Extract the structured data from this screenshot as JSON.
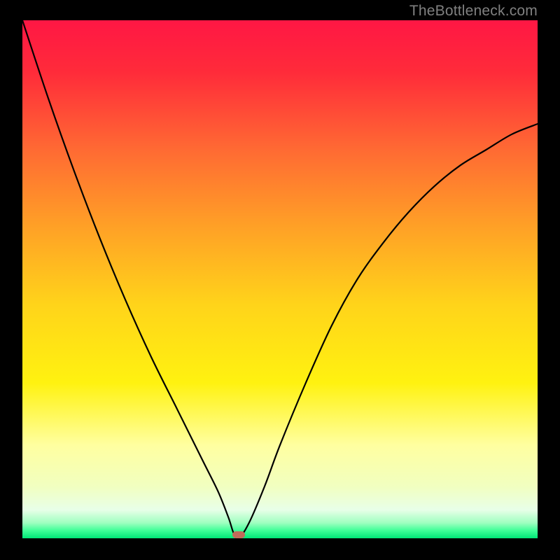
{
  "watermark": "TheBottleneck.com",
  "chart_data": {
    "type": "line",
    "title": "",
    "xlabel": "",
    "ylabel": "",
    "xlim": [
      0,
      100
    ],
    "ylim": [
      0,
      100
    ],
    "grid": false,
    "gradient_stops": [
      {
        "offset": 0.0,
        "color": "#ff1744"
      },
      {
        "offset": 0.1,
        "color": "#ff2b3a"
      },
      {
        "offset": 0.25,
        "color": "#ff6a33"
      },
      {
        "offset": 0.4,
        "color": "#ffa126"
      },
      {
        "offset": 0.55,
        "color": "#ffd41a"
      },
      {
        "offset": 0.7,
        "color": "#fff210"
      },
      {
        "offset": 0.82,
        "color": "#ffffa0"
      },
      {
        "offset": 0.9,
        "color": "#f1ffc0"
      },
      {
        "offset": 0.945,
        "color": "#e8ffe8"
      },
      {
        "offset": 0.97,
        "color": "#a0ffc0"
      },
      {
        "offset": 0.985,
        "color": "#3fff98"
      },
      {
        "offset": 1.0,
        "color": "#00e676"
      }
    ],
    "series": [
      {
        "name": "bottleneck-curve",
        "x": [
          0,
          5,
          10,
          15,
          20,
          25,
          30,
          35,
          38,
          40,
          41,
          42,
          44,
          47,
          50,
          55,
          60,
          65,
          70,
          75,
          80,
          85,
          90,
          95,
          100
        ],
        "values": [
          100,
          85,
          71,
          58,
          46,
          35,
          25,
          15,
          9,
          4,
          1,
          0,
          3,
          10,
          18,
          30,
          41,
          50,
          57,
          63,
          68,
          72,
          75,
          78,
          80
        ]
      }
    ],
    "marker": {
      "x": 42,
      "y": 0.7,
      "w": 2.4,
      "h": 1.3,
      "color": "#c16b5a"
    },
    "curve_color": "#000000",
    "curve_width": 2.2
  }
}
